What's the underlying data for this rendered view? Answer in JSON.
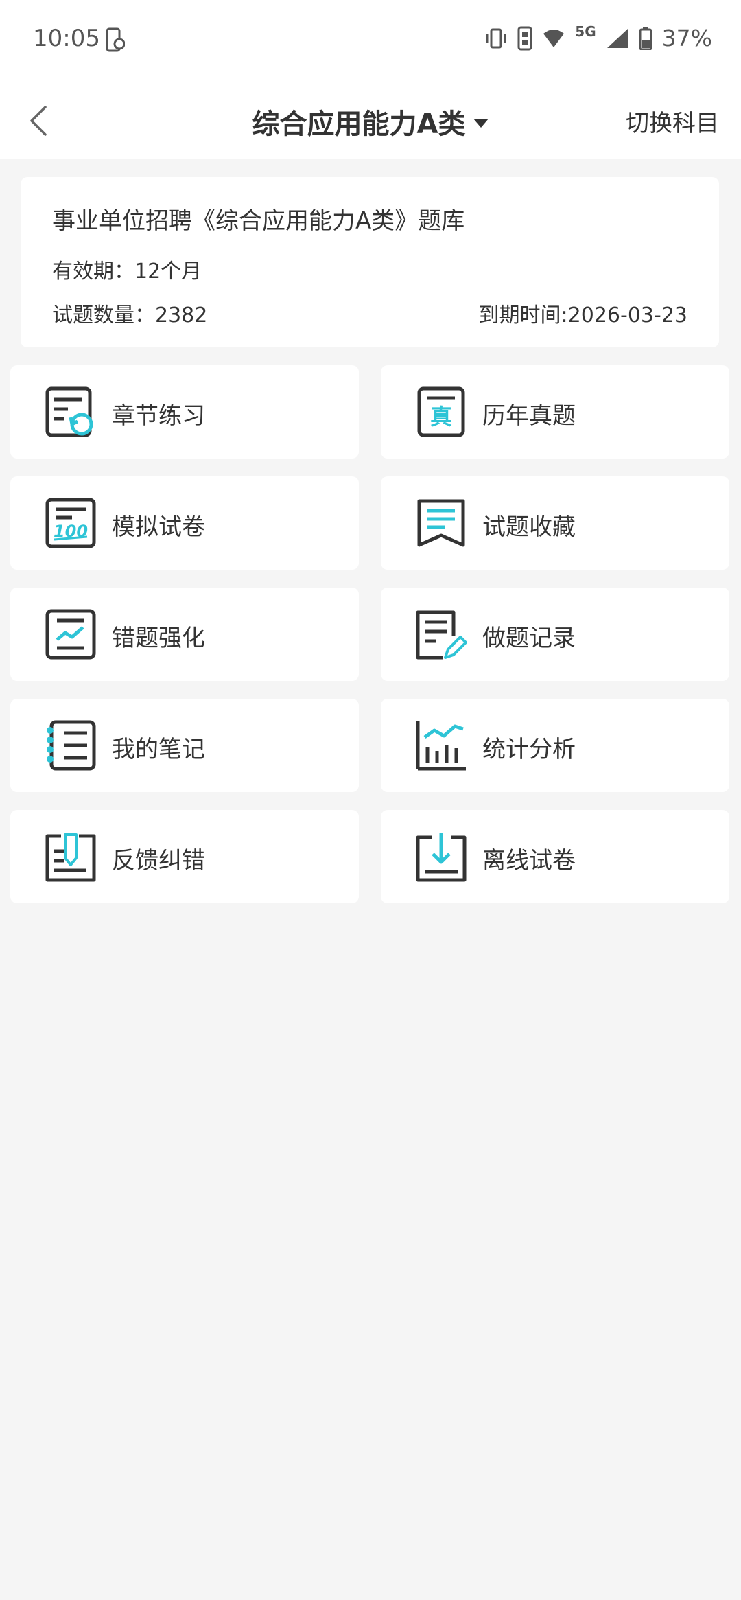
{
  "status_bar": {
    "time": "10:05",
    "network": "5G",
    "battery": "37%"
  },
  "nav": {
    "title": "综合应用能力A类",
    "switch_label": "切换科目"
  },
  "info": {
    "title": "事业单位招聘《综合应用能力A类》题库",
    "validity": "有效期：12个月",
    "count": "试题数量：2382",
    "expire": "到期时间:2026-03-23"
  },
  "menu": [
    {
      "label": "章节练习",
      "icon": "chapter-practice-icon"
    },
    {
      "label": "历年真题",
      "icon": "past-exams-icon"
    },
    {
      "label": "模拟试卷",
      "icon": "mock-paper-icon"
    },
    {
      "label": "试题收藏",
      "icon": "favorites-icon"
    },
    {
      "label": "错题强化",
      "icon": "wrong-questions-icon"
    },
    {
      "label": "做题记录",
      "icon": "practice-record-icon"
    },
    {
      "label": "我的笔记",
      "icon": "notes-icon"
    },
    {
      "label": "统计分析",
      "icon": "statistics-icon"
    },
    {
      "label": "反馈纠错",
      "icon": "feedback-icon"
    },
    {
      "label": "离线试卷",
      "icon": "offline-download-icon"
    }
  ],
  "colors": {
    "accent": "#2ec4d6",
    "icon_dark": "#333333",
    "background": "#f5f5f5"
  }
}
